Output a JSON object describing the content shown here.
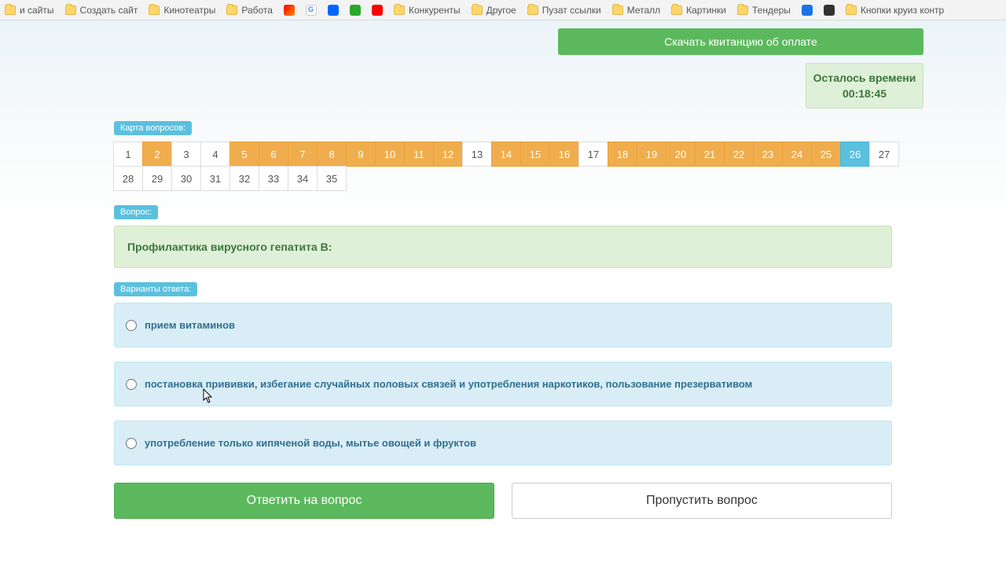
{
  "bookmarks": [
    {
      "label": "и сайты",
      "icon": "folder"
    },
    {
      "label": "Создать сайт",
      "icon": "folder"
    },
    {
      "label": "Кинотеатры",
      "icon": "folder"
    },
    {
      "label": "Работа",
      "icon": "folder"
    },
    {
      "label": "",
      "icon": "fav-y"
    },
    {
      "label": "",
      "icon": "fav-g"
    },
    {
      "label": "",
      "icon": "fav-m"
    },
    {
      "label": "",
      "icon": "fav-v"
    },
    {
      "label": "",
      "icon": "fav-yt"
    },
    {
      "label": "Конкуренты",
      "icon": "folder"
    },
    {
      "label": "Другое",
      "icon": "folder"
    },
    {
      "label": "Пузат ссылки",
      "icon": "folder"
    },
    {
      "label": "Металл",
      "icon": "folder"
    },
    {
      "label": "Картинки",
      "icon": "folder"
    },
    {
      "label": "Тендеры",
      "icon": "folder"
    },
    {
      "label": "",
      "icon": "fav-blue"
    },
    {
      "label": "",
      "icon": "fav-dark"
    },
    {
      "label": "Кнопки круиз контр",
      "icon": "folder"
    }
  ],
  "download_label": "Скачать квитанцию об оплате",
  "timer": {
    "label": "Осталось времени",
    "value": "00:18:45"
  },
  "map_label": "Карта вопросов:",
  "question_label": "Вопрос:",
  "answers_label": "Варианты ответа:",
  "question_text": "Профилактика вирусного гепатита В:",
  "qmap": [
    {
      "n": 1,
      "state": "plain"
    },
    {
      "n": 2,
      "state": "orange"
    },
    {
      "n": 3,
      "state": "plain"
    },
    {
      "n": 4,
      "state": "plain"
    },
    {
      "n": 5,
      "state": "orange"
    },
    {
      "n": 6,
      "state": "orange"
    },
    {
      "n": 7,
      "state": "orange"
    },
    {
      "n": 8,
      "state": "orange"
    },
    {
      "n": 9,
      "state": "orange"
    },
    {
      "n": 10,
      "state": "orange"
    },
    {
      "n": 11,
      "state": "orange"
    },
    {
      "n": 12,
      "state": "orange"
    },
    {
      "n": 13,
      "state": "plain"
    },
    {
      "n": 14,
      "state": "orange"
    },
    {
      "n": 15,
      "state": "orange"
    },
    {
      "n": 16,
      "state": "orange"
    },
    {
      "n": 17,
      "state": "plain"
    },
    {
      "n": 18,
      "state": "orange"
    },
    {
      "n": 19,
      "state": "orange"
    },
    {
      "n": 20,
      "state": "orange"
    },
    {
      "n": 21,
      "state": "orange"
    },
    {
      "n": 22,
      "state": "orange"
    },
    {
      "n": 23,
      "state": "orange"
    },
    {
      "n": 24,
      "state": "orange"
    },
    {
      "n": 25,
      "state": "orange"
    },
    {
      "n": 26,
      "state": "blue"
    },
    {
      "n": 27,
      "state": "plain"
    },
    {
      "n": 28,
      "state": "plain"
    },
    {
      "n": 29,
      "state": "plain"
    },
    {
      "n": 30,
      "state": "plain"
    },
    {
      "n": 31,
      "state": "plain"
    },
    {
      "n": 32,
      "state": "plain"
    },
    {
      "n": 33,
      "state": "plain"
    },
    {
      "n": 34,
      "state": "plain"
    },
    {
      "n": 35,
      "state": "plain"
    }
  ],
  "answers": [
    {
      "text": "прием витаминов"
    },
    {
      "text": "постановка прививки, избегание случайных половых связей и употребления наркотиков, пользование презервативом"
    },
    {
      "text": "употребление только кипяченой воды, мытье овощей и фруктов"
    }
  ],
  "buttons": {
    "answer": "Ответить на вопрос",
    "skip": "Пропустить вопрос"
  }
}
